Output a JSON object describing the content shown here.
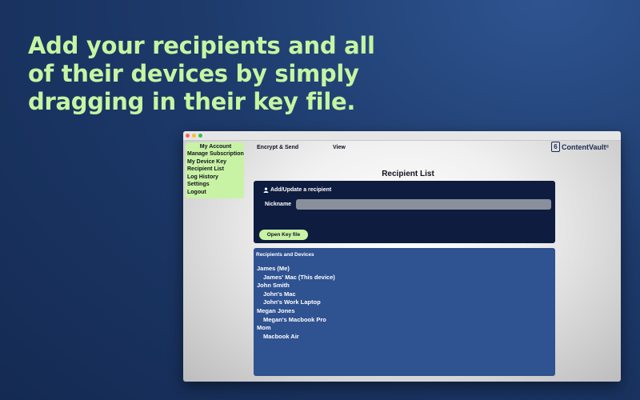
{
  "headline": {
    "lines": [
      "Add your recipients and all",
      "of their devices by simply",
      "dragging in their key file."
    ],
    "color": "#c6f5a2"
  },
  "window": {
    "traffic_lights": [
      "#ff5f57",
      "#febc2e",
      "#28c840"
    ]
  },
  "sidebar": {
    "account_label": "My Account",
    "items": [
      "Manage Subscription",
      "My Device Key",
      "Recipient List",
      "Log History",
      "Settings",
      "Logout"
    ],
    "color": "#c9f3a4"
  },
  "topnav": {
    "items": [
      "Encrypt & Send",
      "View"
    ]
  },
  "logo": {
    "text": "ContentVault",
    "mark": "6",
    "registered": "®"
  },
  "page_title": "Recipient List",
  "add_panel": {
    "header": "Add/Update a recipient",
    "icon": "user-icon",
    "nickname_label": "Nickname",
    "nickname_value": "",
    "open_button": "Open Key file"
  },
  "list_panel": {
    "header": "Recipients and Devices",
    "entries": [
      {
        "text": "James (Me)",
        "type": "recipient"
      },
      {
        "text": "James' Mac (This device)",
        "type": "device"
      },
      {
        "text": "John Smith",
        "type": "recipient"
      },
      {
        "text": "John's Mac",
        "type": "device"
      },
      {
        "text": "John's Work Laptop",
        "type": "device"
      },
      {
        "text": "Megan Jones",
        "type": "recipient"
      },
      {
        "text": "Megan's Macbook Pro",
        "type": "device"
      },
      {
        "text": "Mom",
        "type": "recipient"
      },
      {
        "text": "Macbook Air",
        "type": "device"
      }
    ]
  }
}
